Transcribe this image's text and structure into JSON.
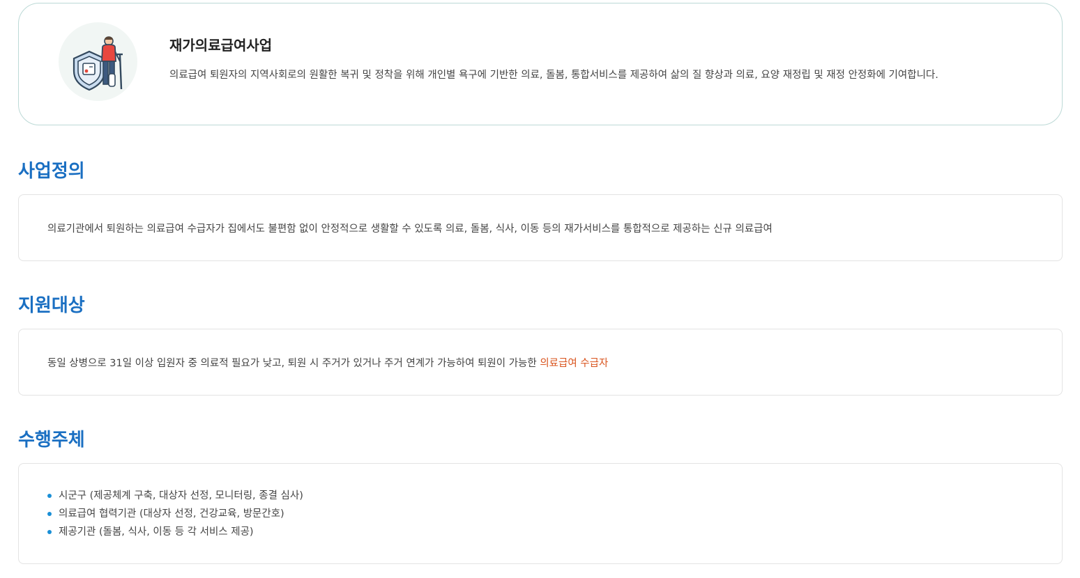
{
  "intro": {
    "icon": "patient-with-crutch-shield-icon",
    "title": "재가의료급여사업",
    "description": "의료급여 퇴원자의 지역사회로의 원활한 복귀 및 정착을 위해 개인별 욕구에 기반한 의료, 돌봄, 통합서비스를 제공하여 삶의 질 향상과 의료, 요양 재정립 및 재정 안정화에 기여합니다."
  },
  "sections": {
    "definition": {
      "title": "사업정의",
      "text": "의료기관에서 퇴원하는 의료급여 수급자가 집에서도 불편함 없이 안정적으로 생활할 수 있도록 의료, 돌봄, 식사, 이동 등의 재가서비스를 통합적으로 제공하는 신규 의료급여"
    },
    "target": {
      "title": "지원대상",
      "text": "동일 상병으로 31일 이상 입원자 중 의료적 필요가 낮고, 퇴원 시 주거가 있거나 주거 연계가 가능하여 퇴원이 가능한 ",
      "highlight": "의료급여 수급자"
    },
    "operator": {
      "title": "수행주체",
      "items": [
        "시군구 (제공체계 구축, 대상자 선정, 모니터링, 종결 심사)",
        "의료급여 협력기관 (대상자 선정, 건강교육, 방문간호)",
        "제공기관 (돌봄, 식사, 이동 등 각 서비스 제공)"
      ]
    }
  },
  "colors": {
    "section_title": "#1a6fc2",
    "highlight": "#d9541e",
    "bullet": "#1a8fd6",
    "card_border": "#bcd9d6",
    "box_border": "#e3e3e3"
  }
}
